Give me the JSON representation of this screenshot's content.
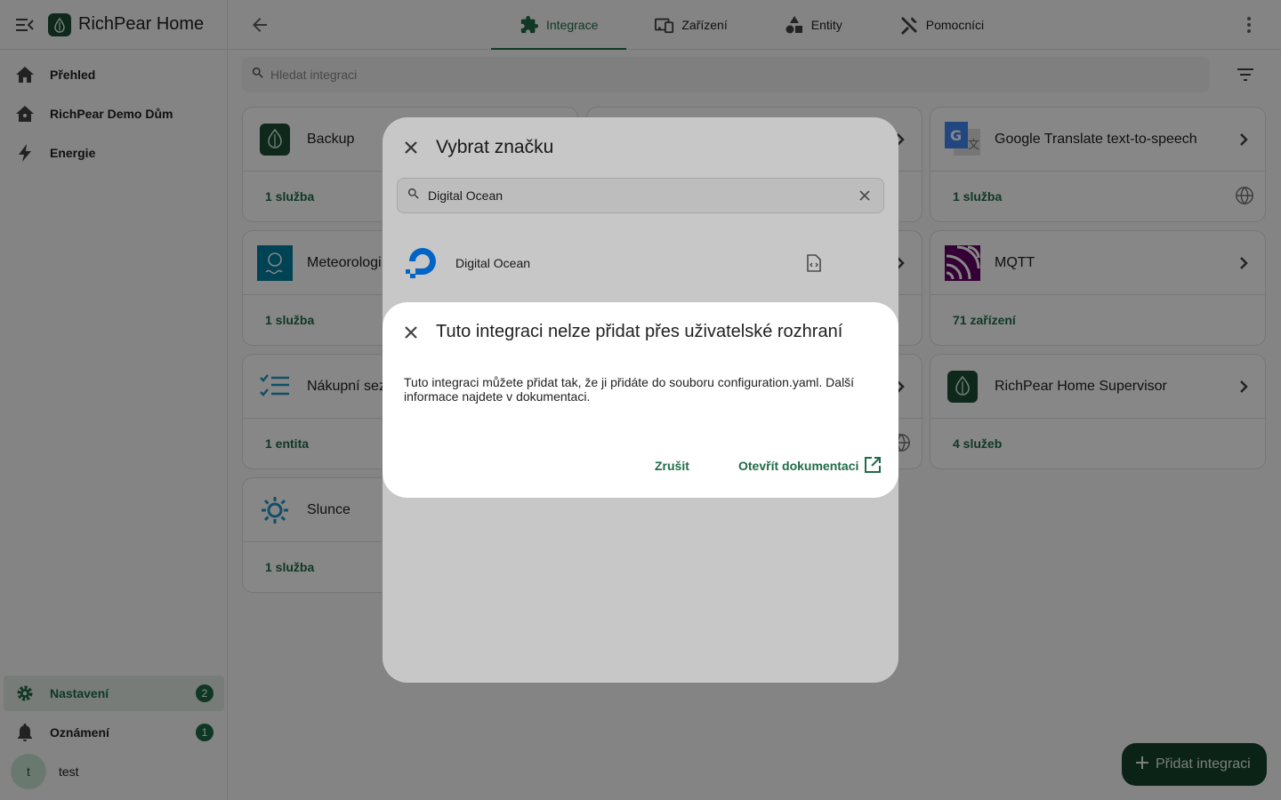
{
  "app": {
    "title": "RichPear Home"
  },
  "sidebar": {
    "items": [
      {
        "label": "Přehled",
        "icon": "home-icon"
      },
      {
        "label": "RichPear Demo Dům",
        "icon": "home-outline-icon"
      },
      {
        "label": "Energie",
        "icon": "lightning-icon"
      }
    ],
    "settings": {
      "label": "Nastavení",
      "badge": "2",
      "icon": "gear-icon"
    },
    "notifications": {
      "label": "Oznámení",
      "badge": "1",
      "icon": "bell-icon"
    },
    "user": {
      "initial": "t",
      "name": "test"
    }
  },
  "tabs": [
    {
      "label": "Integrace",
      "icon": "puzzle-icon",
      "active": true
    },
    {
      "label": "Zařízení",
      "icon": "devices-icon",
      "active": false
    },
    {
      "label": "Entity",
      "icon": "shapes-icon",
      "active": false
    },
    {
      "label": "Pomocníci",
      "icon": "tools-icon",
      "active": false
    }
  ],
  "search": {
    "placeholder": "Hledat integraci"
  },
  "cards": [
    {
      "name": "Backup",
      "footer": "1 služba"
    },
    {
      "name": "Google Translate text-to-speech",
      "footer": "1 služba"
    },
    {
      "name": "Meteorologi",
      "footer": "1 služba"
    },
    {
      "name": "MQTT",
      "footer": "71 zařízení"
    },
    {
      "name": "Nákupní sez",
      "footer": "1 entita"
    },
    {
      "name": "RichPear Home Supervisor",
      "footer": "4 služeb"
    },
    {
      "name": "Slunce",
      "footer": "1 služba"
    }
  ],
  "brand_dialog": {
    "title": "Vybrat značku",
    "search_value": "Digital Ocean",
    "result": "Digital Ocean"
  },
  "alert": {
    "title": "Tuto integraci nelze přidat přes uživatelské rozhraní",
    "body": "Tuto integraci můžete přidat tak, že ji přidáte do souboru configuration.yaml. Další informace najdete v dokumentaci.",
    "cancel": "Zrušit",
    "open_docs": "Otevřít dokumentaci"
  },
  "fab": {
    "label": "Přidat integraci"
  },
  "colors": {
    "primary": "#1f6b47",
    "fab": "#14432c",
    "badge": "#1d6b46"
  }
}
